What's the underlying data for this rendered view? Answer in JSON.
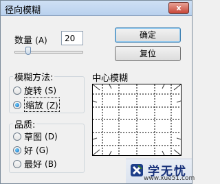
{
  "window": {
    "title": "径向模糊",
    "close_label": "x"
  },
  "amount": {
    "label": "数量",
    "hotkey": "(A)",
    "value": "20",
    "slider_fraction": 0.2
  },
  "buttons": {
    "ok": "确定",
    "reset": "复位"
  },
  "blur_method": {
    "legend": "模糊方法:",
    "options": [
      {
        "label": "旋转",
        "hotkey": "(S)",
        "checked": false
      },
      {
        "label": "缩放",
        "hotkey": "(Z)",
        "checked": true
      }
    ]
  },
  "quality": {
    "legend": "品质:",
    "options": [
      {
        "label": "草图",
        "hotkey": "(D)",
        "checked": false
      },
      {
        "label": "好",
        "hotkey": "(G)",
        "checked": true
      },
      {
        "label": "最好",
        "hotkey": "(B)",
        "checked": false
      }
    ]
  },
  "center": {
    "label": "中心模糊"
  },
  "watermark": {
    "text": "学无忧",
    "url": "www.xue51.com",
    "colors": {
      "logo_primary": "#1e3f8a",
      "logo_accent": "#3a7a2c"
    }
  }
}
